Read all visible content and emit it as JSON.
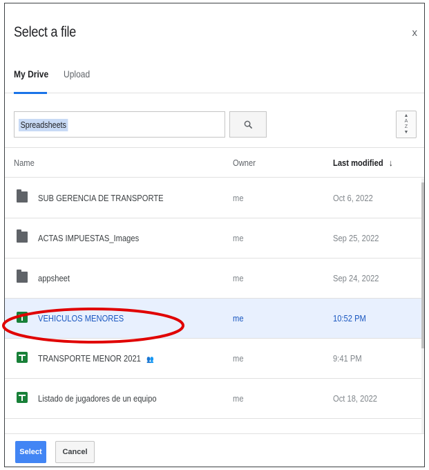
{
  "dialog": {
    "title": "Select a file",
    "close_label": "x"
  },
  "tabs": [
    {
      "label": "My Drive",
      "active": true
    },
    {
      "label": "Upload",
      "active": false
    }
  ],
  "search": {
    "value": "Spreadsheets",
    "button_icon": "search-icon"
  },
  "sort_button": {
    "icon": "sort-az-icon",
    "glyph_top": "A",
    "glyph_bottom": "Z"
  },
  "columns": {
    "name": "Name",
    "owner": "Owner",
    "last_modified": "Last modified",
    "sort_arrow": "↓"
  },
  "files": [
    {
      "name": "SUB GERENCIA DE TRANSPORTE",
      "owner": "me",
      "modified": "Oct 6, 2022",
      "type": "folder",
      "selected": false
    },
    {
      "name": "ACTAS IMPUESTAS_Images",
      "owner": "me",
      "modified": "Sep 25, 2022",
      "type": "folder",
      "selected": false
    },
    {
      "name": "appsheet",
      "owner": "me",
      "modified": "Sep 24, 2022",
      "type": "folder",
      "selected": false
    },
    {
      "name": "VEHICULOS MENORES",
      "owner": "me",
      "modified": "10:52 PM",
      "type": "spreadsheet",
      "selected": true
    },
    {
      "name": "TRANSPORTE MENOR 2021",
      "owner": "me",
      "modified": "9:41 PM",
      "type": "spreadsheet",
      "selected": false,
      "shared": true
    },
    {
      "name": "Listado de jugadores de un equipo",
      "owner": "me",
      "modified": "Oct 18, 2022",
      "type": "spreadsheet",
      "selected": false
    }
  ],
  "shared_icon_glyph": "👥",
  "footer": {
    "select_label": "Select",
    "cancel_label": "Cancel"
  },
  "colors": {
    "accent": "#1a73e8",
    "selected_row": "#e8f0fe",
    "highlight_annotation": "#e00000",
    "sheet_green": "#188038"
  }
}
